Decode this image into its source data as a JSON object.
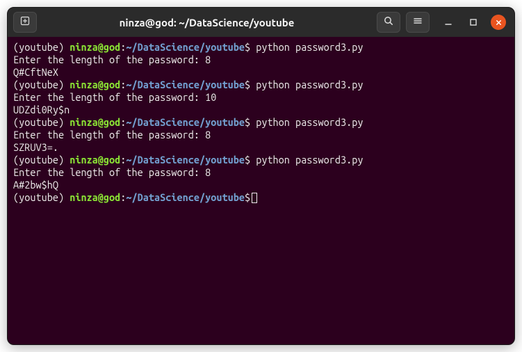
{
  "title": "ninza@god: ~/DataScience/youtube",
  "prompt": {
    "env": "(youtube) ",
    "userhost": "ninza@god",
    "colon": ":",
    "path": "~/DataScience/youtube",
    "dollar": "$"
  },
  "runs": [
    {
      "cmd": " python password3.py",
      "ask": "Enter the length of the password: ",
      "len": "8",
      "out": "Q#CftNeX"
    },
    {
      "cmd": " python password3.py",
      "ask": "Enter the length of the password: ",
      "len": "10",
      "out": "UDZdi0Ry$n"
    },
    {
      "cmd": " python password3.py",
      "ask": "Enter the length of the password: ",
      "len": "8",
      "out": "SZRUV3=."
    },
    {
      "cmd": " python password3.py",
      "ask": "Enter the length of the password: ",
      "len": "8",
      "out": "A#2bw$hQ"
    }
  ],
  "icons": {
    "newtab": "new-tab-icon",
    "search": "search-icon",
    "menu": "menu-icon",
    "minimize": "minimize-icon",
    "maximize": "maximize-icon",
    "close": "close-icon"
  }
}
